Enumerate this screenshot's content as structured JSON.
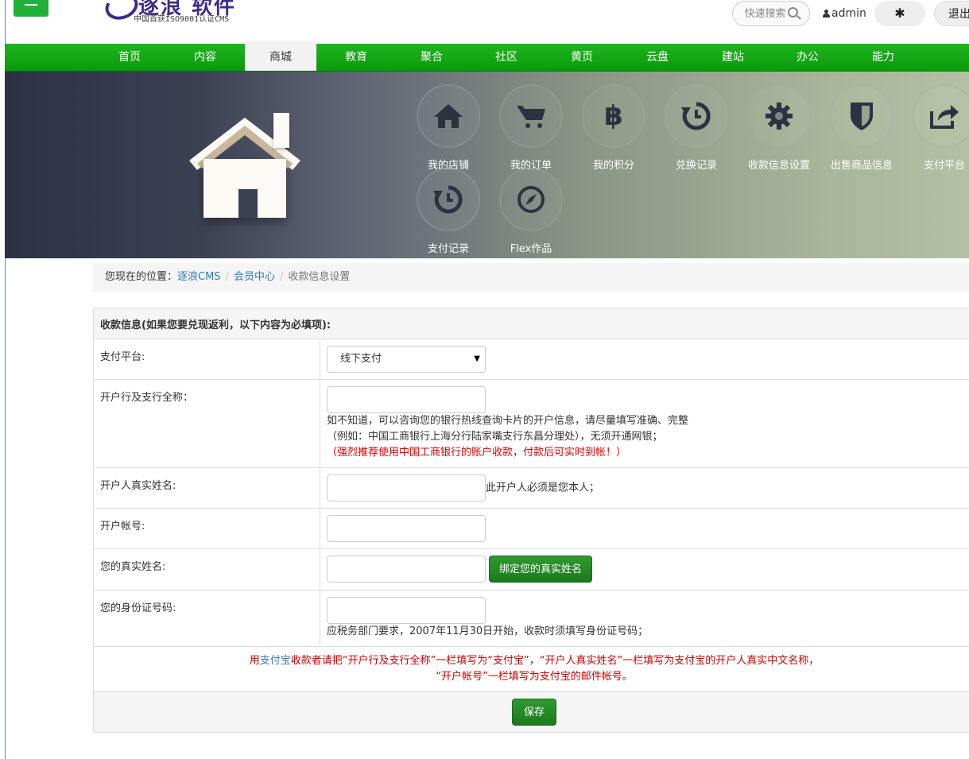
{
  "header": {
    "logo_title": "逐浪 软件",
    "logo_subtitle": "中国首获ISO9001认证CMS",
    "search_label": "快速搜索",
    "username": "admin",
    "logout_label": "退出"
  },
  "nav": {
    "items": [
      "首页",
      "内容",
      "商城",
      "教育",
      "聚合",
      "社区",
      "黄页",
      "云盘",
      "建站",
      "办公",
      "能力"
    ],
    "active": "商城"
  },
  "banner": {
    "icons": [
      {
        "label": "我的店铺",
        "icon": "home-icon"
      },
      {
        "label": "我的订单",
        "icon": "cart-icon"
      },
      {
        "label": "我的积分",
        "icon": "bitcoin-icon"
      },
      {
        "label": "兑换记录",
        "icon": "history-icon"
      },
      {
        "label": "收款信息设置",
        "icon": "gear-icon"
      },
      {
        "label": "出售商品信息",
        "icon": "shield-icon"
      },
      {
        "label": "支付平台",
        "icon": "share-icon"
      },
      {
        "label": "支付记录",
        "icon": "history-icon"
      },
      {
        "label": "Flex作品",
        "icon": "compass-icon"
      }
    ]
  },
  "breadcrumb": {
    "prefix": "您现在的位置：",
    "items": [
      "逐浪CMS",
      "会员中心"
    ],
    "current": "收款信息设置"
  },
  "form": {
    "section_title": "收款信息(如果您要兑现返利，以下内容为必填项):",
    "payment_platform": {
      "label": "支付平台:",
      "selected": "线下支付"
    },
    "bank_name": {
      "label": "开户行及支行全称：",
      "value": "",
      "help_1": "如不知道，可以咨询您的银行热线查询卡片的开户信息，请尽量填写准确、完整",
      "help_2": "（例如：中国工商银行上海分行陆家嘴支行东昌分理处），无须开通网银；",
      "help_red": "（强烈推荐使用中国工商银行的账户收款，付款后可实时到帐！）"
    },
    "account_holder": {
      "label": "开户人真实姓名:",
      "value": "",
      "help": "此开户人必须是您本人；"
    },
    "account_number": {
      "label": "开户帐号:",
      "value": ""
    },
    "real_name": {
      "label": "您的真实姓名:",
      "value": "",
      "bind_button": "绑定您的真实姓名"
    },
    "id_number": {
      "label": "您的身份证号码:",
      "value": "",
      "help": "应税务部门要求，2007年11月30日开始，收款时须填写身份证号码；"
    },
    "alipay_note": {
      "part_1": "用",
      "link": "支付宝",
      "part_2": "收款者请把“开户行及支行全称”一栏填写为“支付宝”，“开户人真实姓名”一栏填写为支付宝的开户人真实中文名称，",
      "line_2": "“开户帐号”一栏填写为支付宝的邮件帐号。"
    },
    "save_button": "保存"
  }
}
